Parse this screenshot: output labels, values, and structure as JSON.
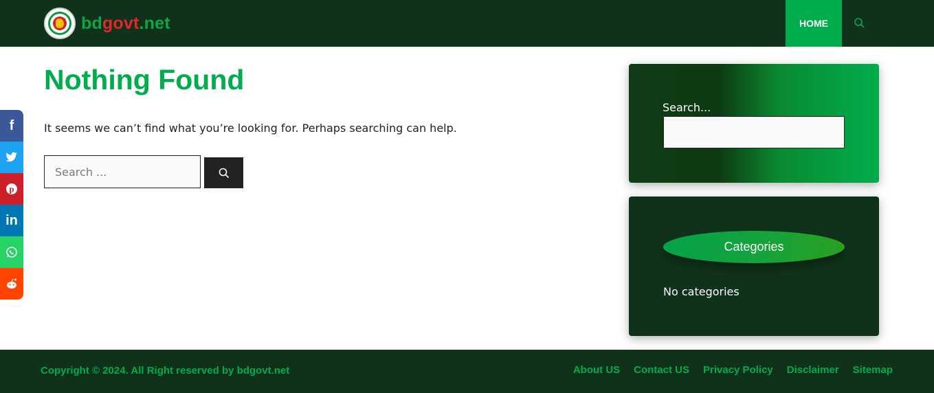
{
  "header": {
    "logo": {
      "part1": "bd",
      "part2": "govt",
      "part3": ".net",
      "emblem_icon": "bangladesh-govt-emblem"
    },
    "nav_home": "HOME",
    "search_icon": "search-icon"
  },
  "main": {
    "title": "Nothing Found",
    "description": "It seems we can’t find what you’re looking for. Perhaps searching can help.",
    "search_placeholder": "Search ...",
    "search_button_icon": "search-icon"
  },
  "social": [
    {
      "name": "facebook",
      "glyph": "f",
      "color": "#3b5998"
    },
    {
      "name": "twitter",
      "glyph": "🐦",
      "color": "#1da1f2"
    },
    {
      "name": "pinterest",
      "glyph": "P",
      "color": "#cb2027"
    },
    {
      "name": "linkedin",
      "glyph": "in",
      "color": "#0077b5"
    },
    {
      "name": "whatsapp",
      "glyph": "✆",
      "color": "#25d366"
    },
    {
      "name": "reddit",
      "glyph": "●",
      "color": "#ff4500"
    }
  ],
  "sidebar": {
    "search_label": "Search...",
    "categories_title": "Categories",
    "no_categories": "No categories"
  },
  "footer": {
    "copyright": "Copyright © 2024. All Right reserved by bdgovt.net",
    "links": [
      "About US",
      "Contact US",
      "Privacy Policy",
      "Disclaimer",
      "Sitemap"
    ]
  },
  "colors": {
    "dark_green": "#10311a",
    "accent_green": "#00ad4c",
    "logo_red": "#e3262c"
  }
}
